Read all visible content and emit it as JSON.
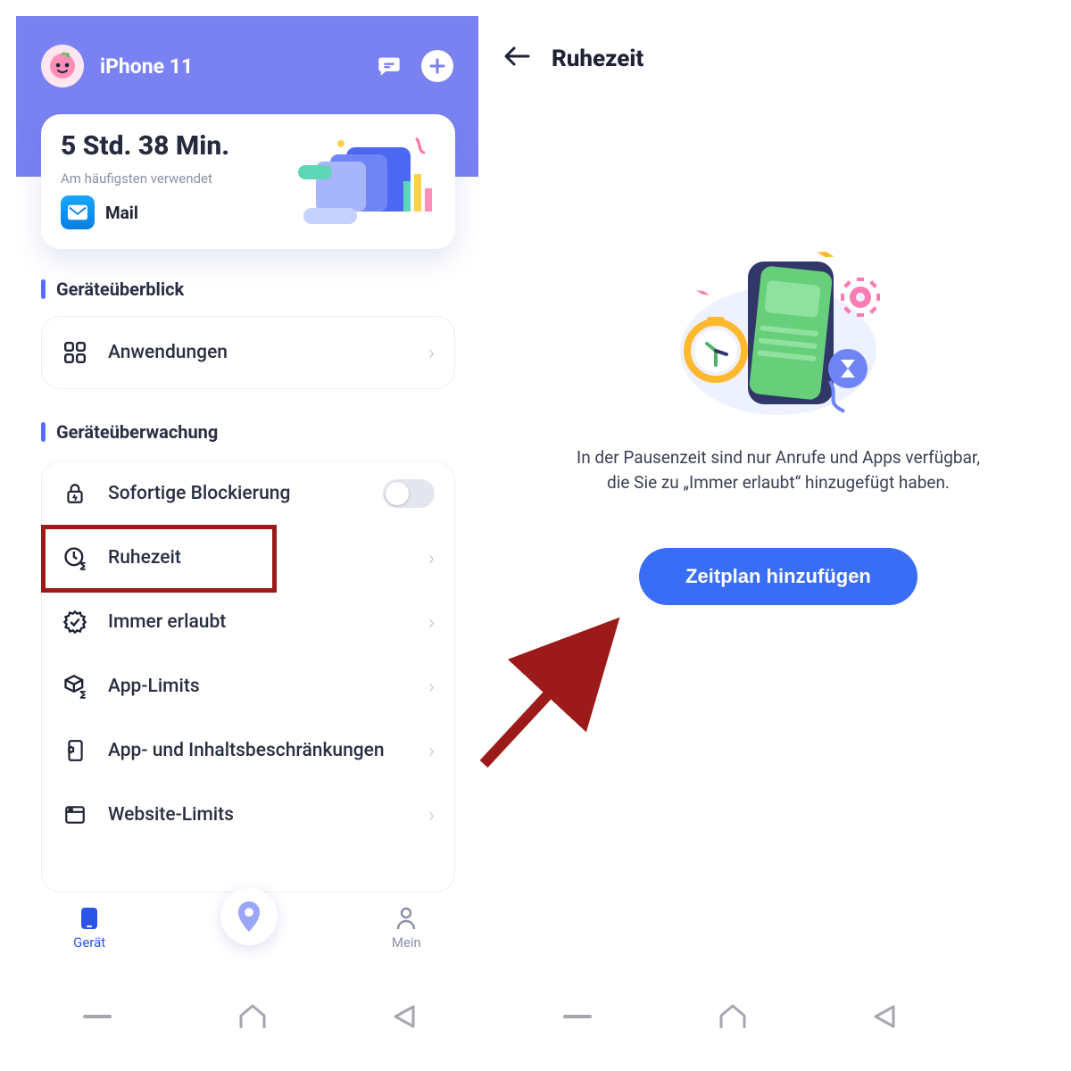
{
  "header": {
    "device_name": "iPhone 11"
  },
  "stats": {
    "time": "5 Std. 38 Min.",
    "subtitle": "Am häufigsten verwendet",
    "app_name": "Mail"
  },
  "sections": {
    "overview_title": "Geräteüberblick",
    "monitor_title": "Geräteüberwachung"
  },
  "overview": {
    "apps_label": "Anwendungen"
  },
  "monitor": {
    "block_label": "Sofortige Blockierung",
    "downtime_label": "Ruhezeit",
    "always_label": "Immer erlaubt",
    "applimits_label": "App-Limits",
    "content_label": "App- und Inhaltsbeschränkungen",
    "weblimits_label": "Website-Limits"
  },
  "tabs": {
    "device_label": "Gerät",
    "mine_label": "Mein"
  },
  "right": {
    "title": "Ruhezeit",
    "description": "In der Pausenzeit sind nur Anrufe und Apps verfügbar, die Sie zu „Immer erlaubt“ hinzugefügt haben.",
    "cta_label": "Zeitplan hinzufügen"
  }
}
